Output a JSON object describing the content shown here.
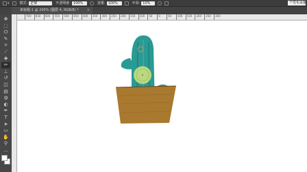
{
  "options_bar": {
    "mode_label": "模式:",
    "mode_value": "正常",
    "opacity_label": "不透明度:",
    "opacity_value": "100%",
    "flow_label": "流量:",
    "flow_value": "100%",
    "smooth_label": "平滑:",
    "smooth_value": "10%",
    "right_label": "个性化设置"
  },
  "document_tab": {
    "title": "未标题-1 @ 200% (图层 4, RGB/8) *",
    "close": "×"
  },
  "ruler": {
    "top_ticks": [
      "700",
      "650",
      "600",
      "550",
      "500",
      "450",
      "400",
      "350",
      "300",
      "250",
      "200",
      "150",
      "100",
      "50",
      "0",
      "50",
      "100",
      "150",
      "200",
      "250",
      "300"
    ]
  },
  "toolbar": {
    "tools": [
      {
        "name": "move-tool",
        "glyph": "✥"
      },
      {
        "name": "marquee-tool",
        "glyph": "⬚"
      },
      {
        "name": "lasso-tool",
        "glyph": "ⵔ"
      },
      {
        "name": "quick-select-tool",
        "glyph": "✎"
      },
      {
        "name": "crop-tool",
        "glyph": "⌗"
      },
      {
        "name": "eyedropper-tool",
        "glyph": "⟋"
      },
      {
        "name": "healing-tool",
        "glyph": "✚"
      },
      {
        "name": "brush-tool",
        "glyph": "✏"
      },
      {
        "name": "stamp-tool",
        "glyph": "⊥"
      },
      {
        "name": "history-brush-tool",
        "glyph": "↺"
      },
      {
        "name": "eraser-tool",
        "glyph": "◫"
      },
      {
        "name": "gradient-tool",
        "glyph": "▤"
      },
      {
        "name": "blur-tool",
        "glyph": "◍"
      },
      {
        "name": "dodge-tool",
        "glyph": "◐"
      },
      {
        "name": "pen-tool",
        "glyph": "✒"
      },
      {
        "name": "type-tool",
        "glyph": "T"
      },
      {
        "name": "path-select-tool",
        "glyph": "➤"
      },
      {
        "name": "shape-tool",
        "glyph": "▭"
      },
      {
        "name": "hand-tool",
        "glyph": "✋"
      },
      {
        "name": "zoom-tool",
        "glyph": "⚲"
      },
      {
        "name": "more-tools",
        "glyph": "…"
      }
    ],
    "foreground_color": "#ffffff",
    "background_color": "#ffffff"
  },
  "colors": {
    "cactus": "#2a9a94",
    "cactus_dark": "#1d7a75",
    "highlight": "#c9df7e",
    "pot": "#a9792f",
    "pot_dark": "#8a5f22"
  }
}
